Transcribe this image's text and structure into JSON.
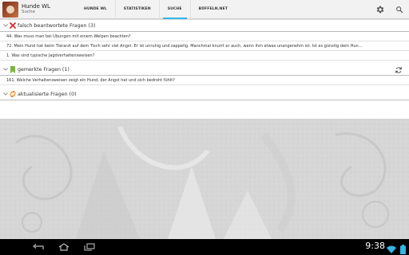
{
  "app": {
    "title": "Hunde WL",
    "subtitle": "Suche"
  },
  "tabs": [
    {
      "label": "HUNDE WL",
      "active": false
    },
    {
      "label": "STATISTIKEN",
      "active": false
    },
    {
      "label": "SUCHE",
      "active": true
    },
    {
      "label": "BÜFFELN.NET",
      "active": false
    }
  ],
  "actionbar_icons": [
    "settings-icon",
    "search-icon"
  ],
  "colors": {
    "accent": "#33b5e5",
    "wrong": "#d32f2f",
    "bookmark": "#7cb342",
    "updated": "#f0a030"
  },
  "sections": [
    {
      "title": "falsch beantwortete Fragen (3)",
      "icon": "red-x-icon",
      "items": [
        "44. Was muss man bei Übungen mit einem Welpen beachten?",
        "72. Mein Hund hat beim Tierarzt auf dem Tisch sehr viel Angst. Er ist unruhig und zappelig. Manchmal knurrt er auch, wenn ihm etwas unangenehm ist. Ist es günstig dem Hun...",
        "1. Was sind typische Jagdverhaltensweisen?"
      ]
    },
    {
      "title": "gemerkte Fragen (1)",
      "icon": "bookmark-icon",
      "action_icon": "refresh-icon",
      "items": [
        "161. Welche Verhaltensweisen zeigt ein Hund, der Angst hat und sich bedroht fühlt?"
      ]
    },
    {
      "title": "aktualisierte Fragen (0)",
      "icon": "updated-arrows-icon",
      "items": []
    }
  ],
  "statusbar": {
    "time": "9:38",
    "icons": [
      "wifi-icon",
      "battery-icon"
    ]
  },
  "navbar": {
    "icons": [
      "back-icon",
      "home-icon",
      "recent-apps-icon"
    ]
  }
}
